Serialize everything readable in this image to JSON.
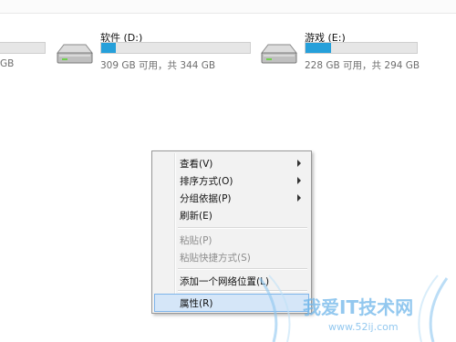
{
  "drives": [
    {
      "name": "",
      "info": "GB",
      "used_fraction": 0.0
    },
    {
      "name": "软件 (D:)",
      "info": "309 GB 可用，共 344 GB",
      "used_fraction": 0.1
    },
    {
      "name": "游戏 (E:)",
      "info": "228 GB 可用，共 294 GB",
      "used_fraction": 0.23
    }
  ],
  "colors": {
    "bar_fill": "#26a0da",
    "menu_hover": "#d5e6f8"
  },
  "context_menu": {
    "items": [
      {
        "label": "查看(V)",
        "submenu": true
      },
      {
        "label": "排序方式(O)",
        "submenu": true
      },
      {
        "label": "分组依据(P)",
        "submenu": true
      },
      {
        "label": "刷新(E)"
      },
      {
        "label": "粘贴(P)",
        "disabled": true
      },
      {
        "label": "粘贴快捷方式(S)",
        "disabled": true
      },
      {
        "label": "添加一个网络位置(L)"
      },
      {
        "label": "属性(R)",
        "highlighted": true
      }
    ]
  },
  "watermark": {
    "text": "我爱IT技术网",
    "url": "www.52ij.com"
  }
}
